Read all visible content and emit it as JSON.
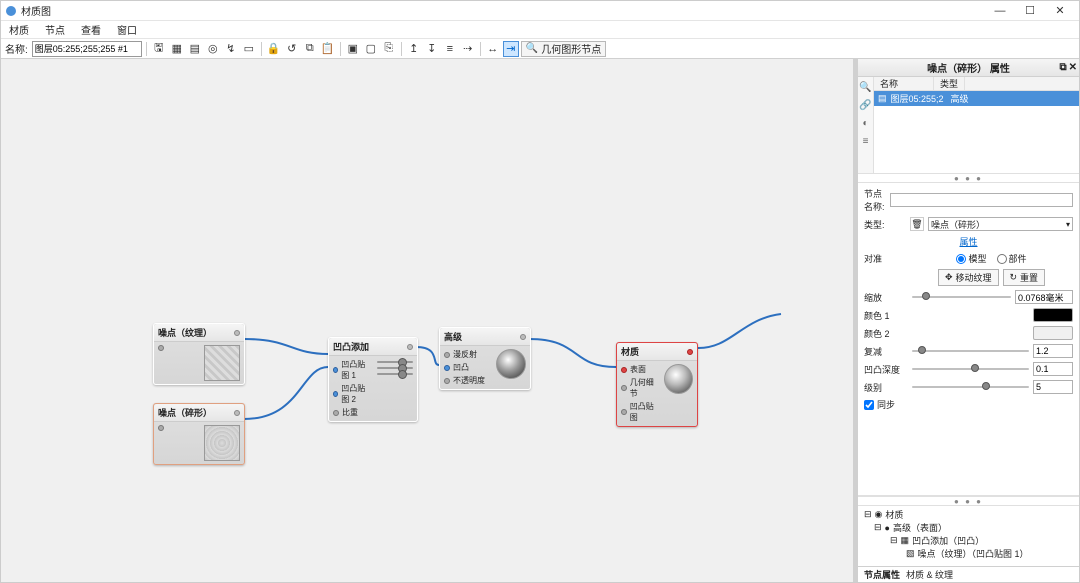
{
  "window": {
    "title": "材质图"
  },
  "menubar": {
    "items": [
      "材质",
      "节点",
      "查看",
      "窗口"
    ]
  },
  "toolbar": {
    "name_label": "名称:",
    "name_value": "图层05:255;255;255 #1",
    "icons": [
      "save-icon",
      "layout-icon",
      "grid-icon",
      "focus-icon",
      "snap-icon",
      "fit-icon",
      "lock-icon",
      "history-icon",
      "copy-icon",
      "paste-icon",
      "group-icon",
      "ungroup-icon",
      "branch-icon",
      "collapse-icon",
      "expand-icon",
      "align-icon",
      "link-icon",
      "cursor-icon",
      "quick-icon"
    ],
    "node_type_label": "几何图形节点"
  },
  "nodes": {
    "n0": {
      "title": "噪点（纹理）",
      "ports": [
        ""
      ]
    },
    "n1": {
      "title": "噪点（碎形）",
      "ports": [
        ""
      ]
    },
    "n2": {
      "title": "凹凸添加",
      "ports": [
        "凹凸贴图 1",
        "凹凸贴图 2",
        "比重"
      ]
    },
    "n3": {
      "title": "高级",
      "ports": [
        "漫反射",
        "凹凸",
        "不透明度"
      ]
    },
    "n4": {
      "title": "材质",
      "ports": [
        "表面",
        "几何细节",
        "凹凸贴图"
      ]
    }
  },
  "side": {
    "header": "噪点（碎形） 属性",
    "list": {
      "col1": "名称",
      "col2": "类型",
      "row_name": "图层05:255;2",
      "row_type": "高级"
    },
    "dots": "● ● ●",
    "props": {
      "node_name_label": "节点名称:",
      "node_name_value": "",
      "type_label": "类型:",
      "type_value": "噪点（碎形）",
      "link_label": "属性",
      "radio": {
        "model": "模型",
        "part": "部件"
      },
      "align_label": "对准",
      "btn_move": "移动纹理",
      "btn_reset": "重置",
      "scale_label": "缩放",
      "scale_value": "0.0768毫米",
      "color1_label": "颜色 1",
      "color1_hex": "#000000",
      "color2_label": "颜色 2",
      "color2_hex": "#f0f0f0",
      "factor_label": "复减",
      "factor_value": "1.2",
      "depth_label": "凹凸深度",
      "depth_value": "0.1",
      "level_label": "级别",
      "level_value": "5",
      "sync_label": "同步"
    },
    "tree": {
      "root": "材质",
      "l1": "高级（表面）",
      "l2": "凹凸添加（凹凸）",
      "l3": "噪点（纹理）（凹凸贴图 1）"
    },
    "tabs": {
      "t1": "节点属性",
      "t2": "材质 & 纹理"
    }
  }
}
